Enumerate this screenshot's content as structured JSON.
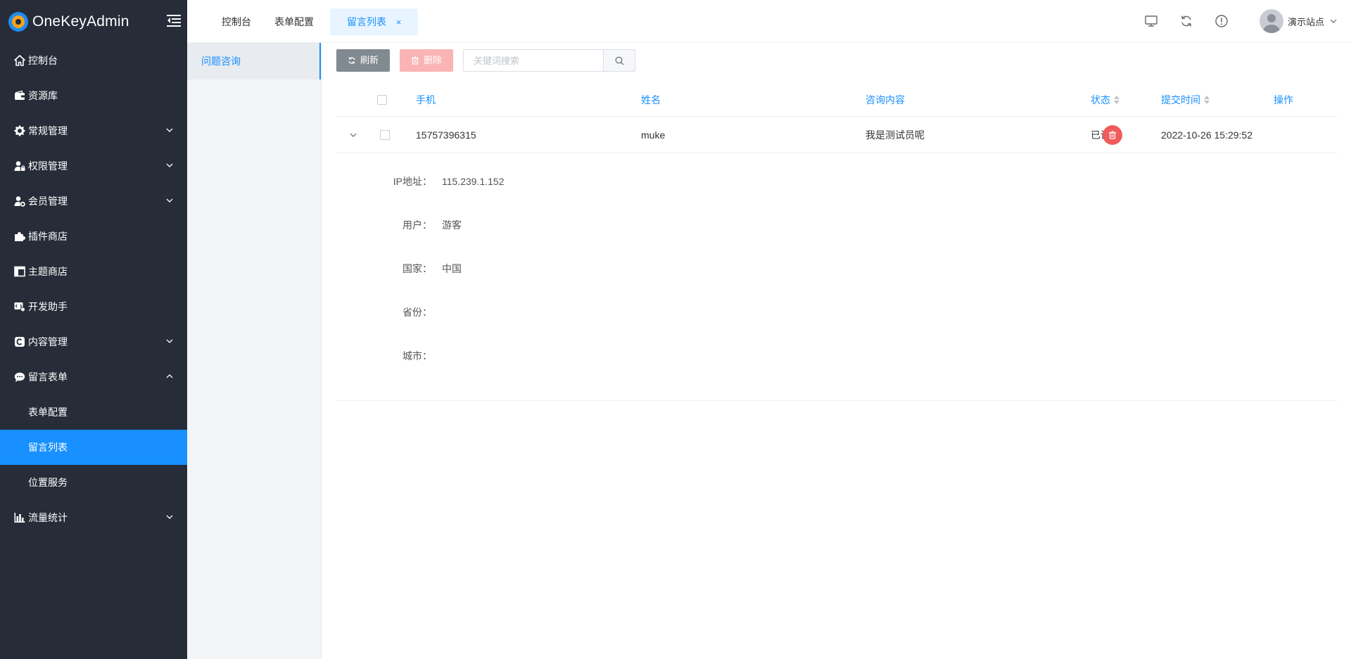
{
  "app": {
    "name": "OneKeyAdmin"
  },
  "sidebar": {
    "items": [
      {
        "label": "控制台",
        "icon": "home-icon"
      },
      {
        "label": "资源库",
        "icon": "wallet-icon"
      },
      {
        "label": "常规管理",
        "icon": "gear-icon"
      },
      {
        "label": "权限管理",
        "icon": "user-lock-icon"
      },
      {
        "label": "会员管理",
        "icon": "user-cog-icon"
      },
      {
        "label": "插件商店",
        "icon": "puzzle-icon"
      },
      {
        "label": "主题商店",
        "icon": "layout-icon"
      },
      {
        "label": "开发助手",
        "icon": "dev-icon"
      },
      {
        "label": "内容管理",
        "icon": "copyright-icon"
      },
      {
        "label": "留言表单",
        "icon": "comment-icon"
      },
      {
        "label": "表单配置"
      },
      {
        "label": "留言列表"
      },
      {
        "label": "位置服务"
      },
      {
        "label": "流量统计",
        "icon": "bar-chart-icon"
      }
    ]
  },
  "header": {
    "tabs": [
      {
        "label": "控制台"
      },
      {
        "label": "表单配置"
      },
      {
        "label": "留言列表"
      }
    ],
    "user_name": "演示站点"
  },
  "panel": {
    "items": [
      {
        "label": "问题咨询"
      }
    ]
  },
  "toolbar": {
    "refresh_label": "刷新",
    "delete_label": "删除",
    "search_placeholder": "关键词搜索",
    "search_value": ""
  },
  "table": {
    "columns": {
      "phone": "手机",
      "name": "姓名",
      "content": "咨询内容",
      "status": "状态",
      "time": "提交时间",
      "action": "操作"
    },
    "rows": [
      {
        "phone": "15757396315",
        "name": "muke",
        "content": "我是测试员呢",
        "status": "已读",
        "time": "2022-10-26 15:29:52",
        "details": [
          {
            "label": "IP地址：",
            "value": "115.239.1.152"
          },
          {
            "label": "用户：",
            "value": "游客"
          },
          {
            "label": "国家：",
            "value": "中国"
          },
          {
            "label": "省份：",
            "value": ""
          },
          {
            "label": "城市：",
            "value": ""
          }
        ]
      }
    ]
  },
  "colors": {
    "primary": "#1890ff",
    "sidebar_bg": "#262c38",
    "danger": "#f05c5c",
    "danger_light": "#fab4b4",
    "neutral_btn": "#818991"
  }
}
